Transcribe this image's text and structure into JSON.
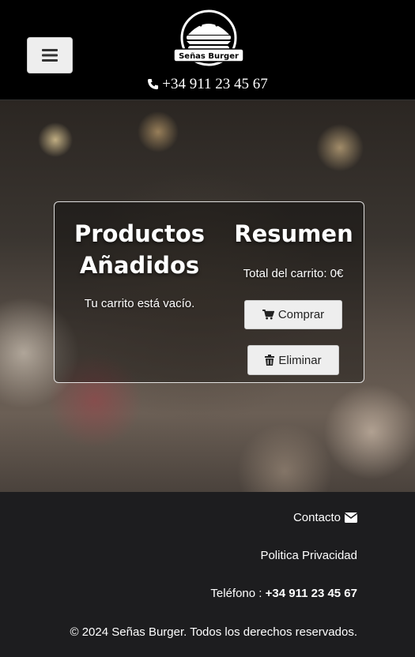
{
  "header": {
    "menu_icon": "hamburger-menu-icon",
    "logo_text": "Señas Burger",
    "phone_icon": "phone-icon",
    "phone": "+34 911 23 45 67"
  },
  "cart": {
    "products_title": "Productos Añadidos",
    "empty_message": "Tu carrito está vacío.",
    "summary_title": "Resumen",
    "total_text": "Total del carrito: 0€",
    "buy_label": "Comprar",
    "buy_icon": "cart-icon",
    "delete_label": "Eliminar",
    "delete_icon": "trash-icon"
  },
  "footer": {
    "contact_label": "Contacto",
    "contact_icon": "envelope-icon",
    "privacy_label": "Politica Privacidad",
    "phone_label": "Teléfono :",
    "phone_value": "+34 911 23 45 67",
    "copyright": "© 2024 Señas Burger. Todos los derechos reservados."
  },
  "colors": {
    "header_bg": "#000000",
    "footer_bg": "#1d1d1f",
    "button_bg": "#eeeeee"
  }
}
